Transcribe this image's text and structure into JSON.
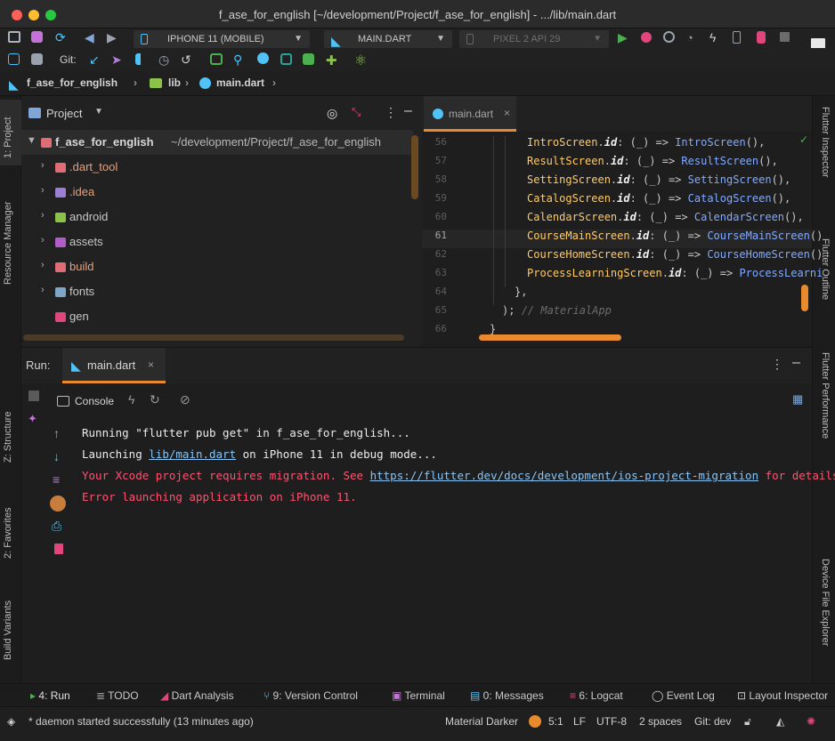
{
  "window": {
    "title": "f_ase_for_english [~/development/Project/f_ase_for_english] - .../lib/main.dart"
  },
  "toolbar": {
    "device_selector": "IPHONE 11 (MOBILE)",
    "run_config": "MAIN.DART",
    "emulator": "PIXEL 2 API 29",
    "git_label": "Git:"
  },
  "breadcrumb": {
    "project": "f_ase_for_english",
    "folder": "lib",
    "file": "main.dart"
  },
  "left_tools": [
    "1: Project",
    "Resource Manager",
    "Z: Structure",
    "2: Favorites",
    "Build Variants"
  ],
  "right_tools": [
    "Flutter Inspector",
    "Flutter Outline",
    "Flutter Performance",
    "Device File Explorer"
  ],
  "project_panel": {
    "title": "Project",
    "root_name": "f_ase_for_english",
    "root_path": "~/development/Project/f_ase_for_english",
    "items": [
      {
        "name": ".dart_tool",
        "color": "#e06c75"
      },
      {
        "name": ".idea",
        "color": "#9b7fd4"
      },
      {
        "name": "android",
        "color": "#8bc34a"
      },
      {
        "name": "assets",
        "color": "#b05cc9"
      },
      {
        "name": "build",
        "color": "#e06c75"
      },
      {
        "name": "fonts",
        "color": "#7da6c9"
      },
      {
        "name": "gen",
        "color": "#e0457b"
      }
    ]
  },
  "editor": {
    "tab": "main.dart",
    "lines": [
      {
        "n": "56",
        "cls": "IntroScreen",
        "fld": "id",
        "mid": ": (_) => ",
        "fn": "IntroScreen",
        "end": "(),"
      },
      {
        "n": "57",
        "cls": "ResultScreen",
        "fld": "id",
        "mid": ": (_) => ",
        "fn": "ResultScreen",
        "end": "(),"
      },
      {
        "n": "58",
        "cls": "SettingScreen",
        "fld": "id",
        "mid": ": (_) => ",
        "fn": "SettingScreen",
        "end": "(),"
      },
      {
        "n": "59",
        "cls": "CatalogScreen",
        "fld": "id",
        "mid": ": (_) => ",
        "fn": "CatalogScreen",
        "end": "(),"
      },
      {
        "n": "60",
        "cls": "CalendarScreen",
        "fld": "id",
        "mid": ": (_) => ",
        "fn": "CalendarScreen",
        "end": "(),"
      },
      {
        "n": "61",
        "cls": "CourseMainScreen",
        "fld": "id",
        "mid": ": (_) => ",
        "fn": "CourseMainScreen",
        "end": "()"
      },
      {
        "n": "62",
        "cls": "CourseHomeScreen",
        "fld": "id",
        "mid": ": (_) => ",
        "fn": "CourseHomeScreen",
        "end": "()"
      },
      {
        "n": "63",
        "cls": "ProcessLearningScreen",
        "fld": "id",
        "mid": ": (_) => ",
        "fn": "ProcessLearni",
        "end": ""
      }
    ],
    "line64": {
      "n": "64",
      "text": "},"
    },
    "line65": {
      "n": "65",
      "text": ");",
      "comment": "// MaterialApp"
    },
    "line66": {
      "n": "66",
      "text": "}"
    }
  },
  "run_panel": {
    "label": "Run:",
    "tab": "main.dart",
    "console": "Console",
    "output": {
      "l1": "Running \"flutter pub get\" in f_ase_for_english...",
      "l2_pre": "Launching ",
      "l2_link": "lib/main.dart",
      "l2_post": " on iPhone 11 in debug mode...",
      "l3_pre": "Your Xcode project requires migration. See ",
      "l3_link": "https://flutter.dev/docs/development/ios-project-migration",
      "l3_post": " for details.",
      "l4": "Error launching application on iPhone 11."
    }
  },
  "bottom_tools": [
    "4: Run",
    "TODO",
    "Dart Analysis",
    "9: Version Control",
    "Terminal",
    "0: Messages",
    "6: Logcat",
    "Event Log",
    "Layout Inspector"
  ],
  "status": {
    "message": "* daemon started successfully (13 minutes ago)",
    "theme": "Material Darker",
    "position": "5:1",
    "line_sep": "LF",
    "encoding": "UTF-8",
    "indent": "2 spaces",
    "vcs": "Git: dev"
  },
  "colors": {
    "accent": "#e88a2d",
    "error": "#ff5370",
    "link": "#89c4f4"
  }
}
